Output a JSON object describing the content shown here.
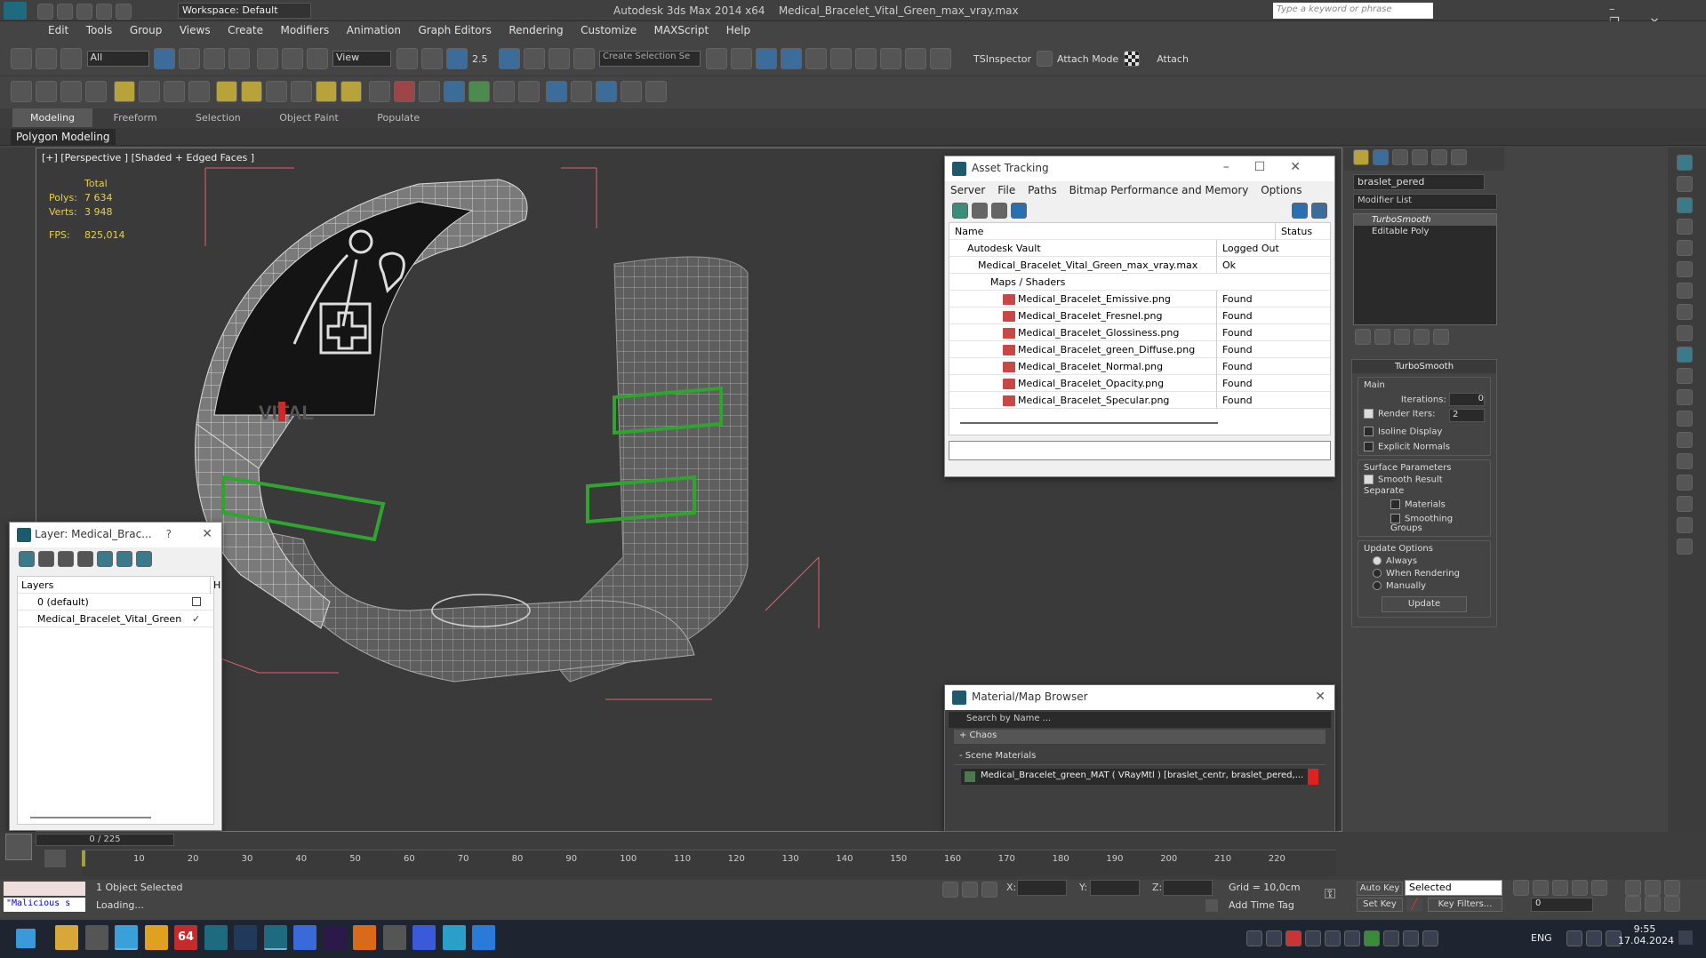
{
  "title_bar": {
    "workspace_label": "Workspace: Default",
    "app_title": "Autodesk 3ds Max  2014 x64",
    "file_name": "Medical_Bracelet_Vital_Green_max_vray.max",
    "search_placeholder": "Type a keyword or phrase"
  },
  "menu": [
    "Edit",
    "Tools",
    "Group",
    "Views",
    "Create",
    "Modifiers",
    "Animation",
    "Graph Editors",
    "Rendering",
    "Customize",
    "MAXScript",
    "Help"
  ],
  "toolbar": {
    "filter_value": "All",
    "ref_coord_value": "View",
    "selection_set_value": "Create Selection Se",
    "snap_value": "2.5",
    "tsinspector_label": "TSInspector",
    "attach_mode_label": "Attach Mode",
    "attach_label": "Attach"
  },
  "ribbon": {
    "tabs": [
      "Modeling",
      "Freeform",
      "Selection",
      "Object Paint",
      "Populate"
    ],
    "sub_label": "Polygon Modeling"
  },
  "viewport": {
    "label": "[+] [Perspective ] [Shaded + Edged Faces ]",
    "stats_header": "Total",
    "polys_label": "Polys:",
    "polys_value": "7 634",
    "verts_label": "Verts:",
    "verts_value": "3 948",
    "fps_label": "FPS:",
    "fps_value": "825,014"
  },
  "asset_tracking": {
    "title": "Asset Tracking",
    "menu": [
      "Server",
      "File",
      "Paths",
      "Bitmap Performance and Memory",
      "Options"
    ],
    "col_name": "Name",
    "col_status": "Status",
    "rows": [
      {
        "name": "Autodesk Vault",
        "status": "Logged Out",
        "indent": 1
      },
      {
        "name": "Medical_Bracelet_Vital_Green_max_vray.max",
        "status": "Ok",
        "indent": 2
      },
      {
        "name": "Maps / Shaders",
        "status": "",
        "indent": 3
      },
      {
        "name": "Medical_Bracelet_Emissive.png",
        "status": "Found",
        "indent": 4
      },
      {
        "name": "Medical_Bracelet_Fresnel.png",
        "status": "Found",
        "indent": 4
      },
      {
        "name": "Medical_Bracelet_Glossiness.png",
        "status": "Found",
        "indent": 4
      },
      {
        "name": "Medical_Bracelet_green_Diffuse.png",
        "status": "Found",
        "indent": 4
      },
      {
        "name": "Medical_Bracelet_Normal.png",
        "status": "Found",
        "indent": 4
      },
      {
        "name": "Medical_Bracelet_Opacity.png",
        "status": "Found",
        "indent": 4
      },
      {
        "name": "Medical_Bracelet_Specular.png",
        "status": "Found",
        "indent": 4
      }
    ]
  },
  "layer_window": {
    "title": "Layer: Medical_Brac...",
    "help": "?",
    "col_layers": "Layers",
    "col_h": "H",
    "rows": [
      "0 (default)",
      "Medical_Bracelet_Vital_Green"
    ]
  },
  "material_browser": {
    "title": "Material/Map Browser",
    "search_placeholder": "Search by Name ...",
    "group_chaos": "+ Chaos",
    "group_scene": "- Scene Materials",
    "material_entry": "Medical_Bracelet_green_MAT ( VRayMtl ) [braslet_centr, braslet_pered,..."
  },
  "command_panel": {
    "object_name": "braslet_pered",
    "modifier_list": "Modifier List",
    "stack": [
      "TurboSmooth",
      "Editable Poly"
    ],
    "rollout_title": "TurboSmooth",
    "main_label": "Main",
    "iterations_label": "Iterations:",
    "iterations_value": "0",
    "render_iters_label": "Render Iters:",
    "render_iters_value": "2",
    "isoline_label": "Isoline Display",
    "explicit_normals_label": "Explicit Normals",
    "surface_params_label": "Surface Parameters",
    "smooth_result_label": "Smooth Result",
    "separate_label": "Separate",
    "materials_label": "Materials",
    "smoothing_groups_label": "Smoothing Groups",
    "update_options_label": "Update Options",
    "always_label": "Always",
    "when_rendering_label": "When Rendering",
    "manually_label": "Manually",
    "update_button": "Update"
  },
  "timeline": {
    "frame_readout": "0 / 225",
    "ticks": [
      "10",
      "20",
      "30",
      "40",
      "50",
      "60",
      "70",
      "80",
      "90",
      "100",
      "110",
      "120",
      "130",
      "140",
      "150",
      "160",
      "170",
      "180",
      "190",
      "200",
      "210",
      "220"
    ]
  },
  "status": {
    "selection_text": "1 Object Selected",
    "loading_text": "Loading...",
    "script_text": "\"Malicious s",
    "x_label": "X:",
    "y_label": "Y:",
    "z_label": "Z:",
    "grid_text": "Grid = 10,0cm",
    "add_time_tag": "Add Time Tag",
    "auto_key": "Auto Key",
    "set_key": "Set Key",
    "selected_value": "Selected",
    "key_filters": "Key Filters...",
    "frame_value": "0"
  },
  "taskbar": {
    "lang": "ENG",
    "time": "9:55",
    "date": "17.04.2024",
    "badge": "64"
  }
}
